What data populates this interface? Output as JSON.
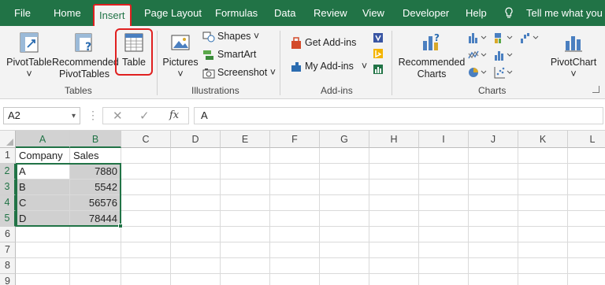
{
  "tabs": [
    "File",
    "Home",
    "Insert",
    "Page Layout",
    "Formulas",
    "Data",
    "Review",
    "View",
    "Developer",
    "Help",
    "Tell me what you w"
  ],
  "ribbon": {
    "tables": {
      "pivot_line1": "PivotTable",
      "pivot_line2": "˅",
      "rec_line1": "Recommended",
      "rec_line2": "PivotTables",
      "table": "Table",
      "label": "Tables"
    },
    "illustrations": {
      "pictures": "Pictures",
      "pictures_dd": "˅",
      "shapes": "Shapes ˅",
      "smartart": "SmartArt",
      "screenshot": "Screenshot ˅",
      "label": "Illustrations"
    },
    "addins": {
      "get": "Get Add-ins",
      "my": "My Add-ins",
      "my_dd": "˅",
      "label": "Add-ins"
    },
    "charts": {
      "rec_line1": "Recommended",
      "rec_line2": "Charts",
      "pivotchart": "PivotChart",
      "pivotchart_dd": "˅",
      "label": "Charts"
    }
  },
  "formula_bar": {
    "name_box": "A2",
    "name_box_dd": "▾",
    "cancel": "✕",
    "enter": "✓",
    "fx": "fx",
    "content": "A"
  },
  "sheet": {
    "columns": [
      "A",
      "B",
      "C",
      "D",
      "E",
      "F",
      "G",
      "H",
      "I",
      "J",
      "K",
      "L"
    ],
    "rows": [
      "1",
      "2",
      "3",
      "4",
      "5",
      "6",
      "7",
      "8",
      "9"
    ],
    "cells": {
      "A1": "Company",
      "B1": "Sales",
      "A2": "A",
      "B2": "7880",
      "A3": "B",
      "B3": "5542",
      "A4": "C",
      "B4": "56576",
      "A5": "D",
      "B5": "78444"
    }
  },
  "colors": {
    "accent": "#217346",
    "highlight": "#e02020"
  }
}
